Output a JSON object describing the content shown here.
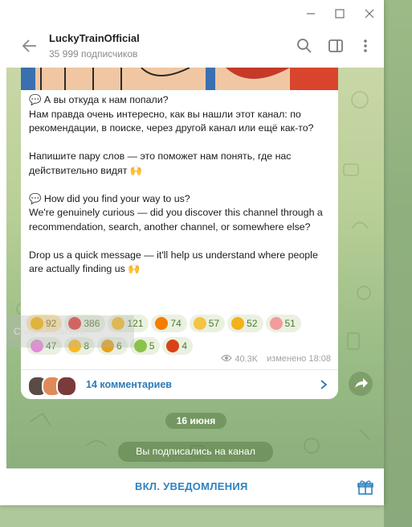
{
  "window": {
    "controls": [
      "minimize",
      "maximize",
      "close"
    ]
  },
  "header": {
    "title": "LuckyTrainOfficial",
    "subtitle": "35 999 подписчиков",
    "icons": [
      "back-arrow-icon",
      "search-icon",
      "sidebar-toggle-icon",
      "more-vertical-icon"
    ]
  },
  "message": {
    "lines": [
      "💬 А вы откуда к нам попали?",
      "Нам правда очень интересно, как вы нашли этот канал: по рекомендации, в поиске, через другой канал или ещё как-то?",
      "",
      "Напишите пару слов — это поможет нам понять, где нас действительно видят 🙌",
      "",
      "💬 How did you find your way to us?",
      "We're genuinely curious — did you discover this channel through a recommendation, search, another channel, or somewhere else?",
      "",
      "Drop us a quick message — it'll help us understand where people are actually finding us 🙌"
    ],
    "reactions_row1": [
      {
        "emoji": "star",
        "count": "92",
        "color": "#f4b400",
        "active": true
      },
      {
        "emoji": "heart",
        "count": "386",
        "color": "#e53935",
        "active": false
      },
      {
        "emoji": "thumbs-up",
        "count": "121",
        "color": "#f7b924",
        "active": false
      },
      {
        "emoji": "fire",
        "count": "74",
        "color": "#f57c00",
        "active": false
      },
      {
        "emoji": "clap",
        "count": "57",
        "color": "#f6c343",
        "active": false
      },
      {
        "emoji": "star-struck",
        "count": "52",
        "color": "#f3b21b",
        "active": false
      },
      {
        "emoji": "smiling-hearts",
        "count": "51",
        "color": "#f29c9c",
        "active": false
      }
    ],
    "reactions_row2": [
      {
        "emoji": "party-popper",
        "count": "47",
        "color": "#e58ad8",
        "active": false
      },
      {
        "emoji": "thumbs-down",
        "count": "8",
        "color": "#f7b924",
        "active": false
      },
      {
        "emoji": "trophy",
        "count": "6",
        "color": "#e2a21a",
        "active": false
      },
      {
        "emoji": "nauseated",
        "count": "5",
        "color": "#8bc34a",
        "active": false
      },
      {
        "emoji": "angry-face",
        "count": "4",
        "color": "#d84315",
        "active": false
      }
    ],
    "views": "40.3K",
    "edited": "изменено 18:08",
    "comments_label": "14 комментариев"
  },
  "date_separator": "16 июня",
  "service_message": "Вы подписались на канал",
  "bottom": {
    "notify_label": "ВКЛ. УВЕДОМЛЕНИЯ"
  },
  "ghost": {
    "text": "Сохр. о новости"
  }
}
